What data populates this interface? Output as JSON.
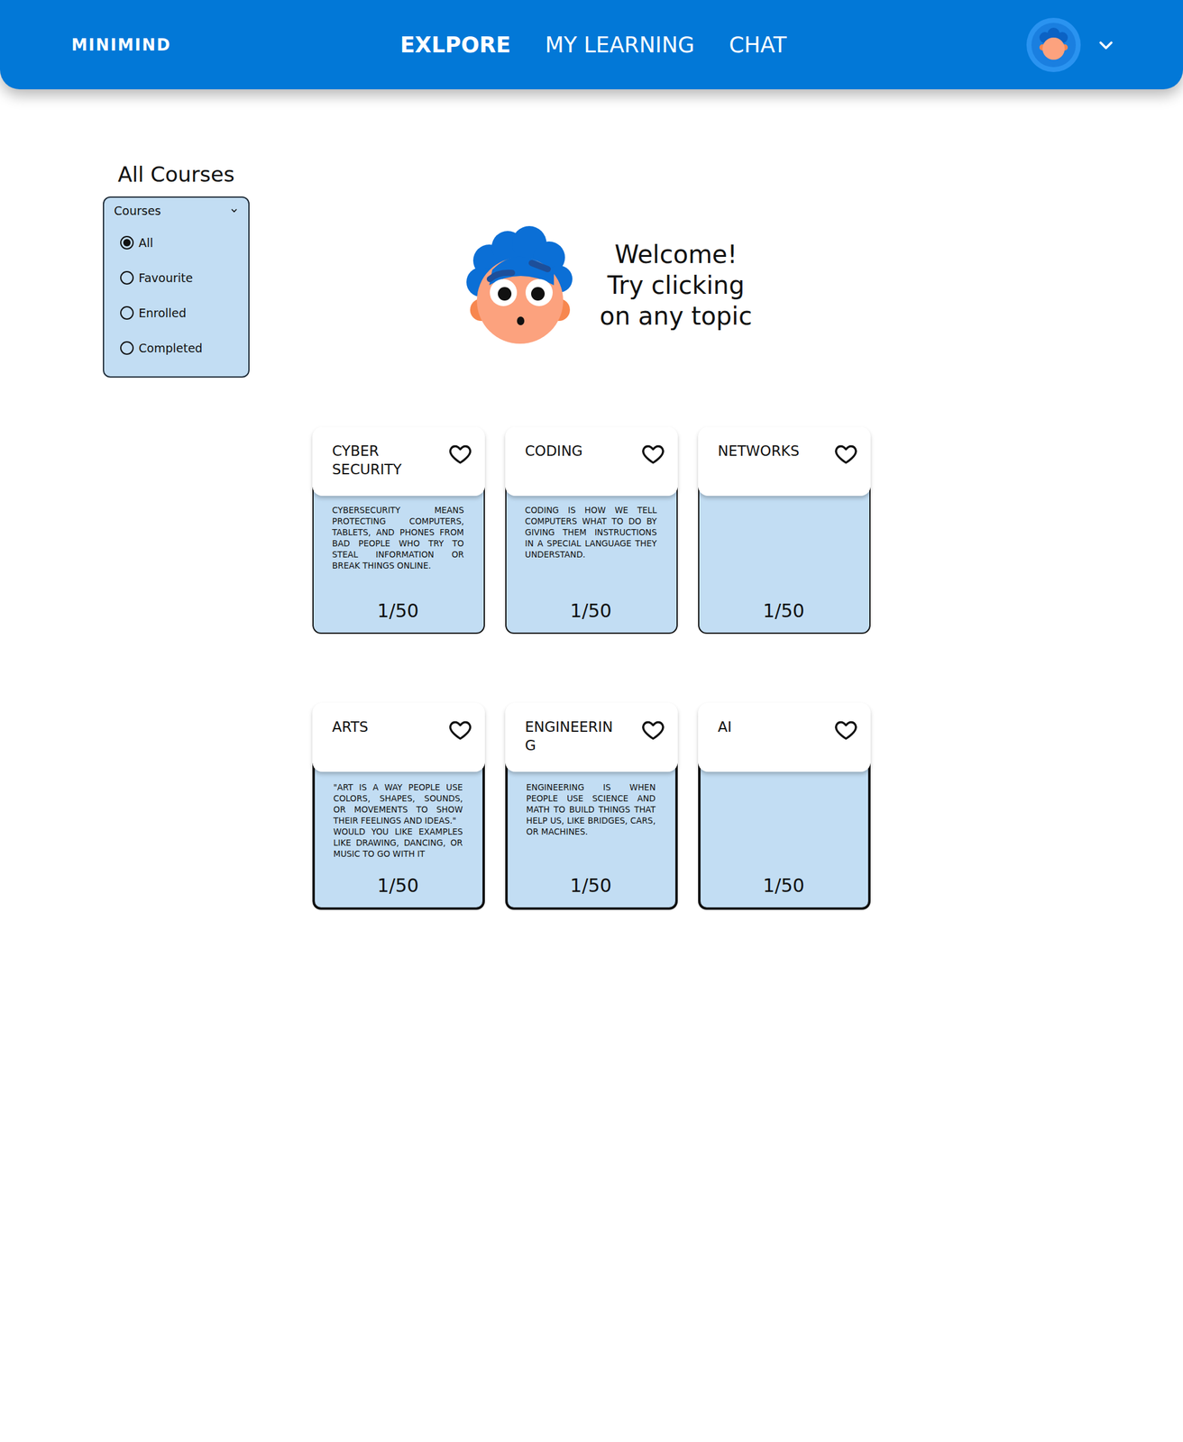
{
  "header": {
    "logo": "MINIMIND",
    "nav": [
      {
        "label": "EXLPORE",
        "selected": true
      },
      {
        "label": "MY LEARNING",
        "selected": false
      },
      {
        "label": "CHAT",
        "selected": false
      }
    ]
  },
  "filter": {
    "title": "All Courses",
    "label": "Courses",
    "options": [
      {
        "label": "All",
        "selected": true
      },
      {
        "label": "Favourite",
        "selected": false
      },
      {
        "label": "Enrolled",
        "selected": false
      },
      {
        "label": "Completed",
        "selected": false
      }
    ]
  },
  "welcome": {
    "lines": [
      "Welcome!",
      "Try clicking",
      "on any topic"
    ]
  },
  "courses": [
    {
      "title": "CYBER SECURITY",
      "favourite": false,
      "description": "CYBERSECURITY MEANS PROTECTING COMPUTERS, TABLETS, AND PHONES FROM BAD PEOPLE WHO TRY TO STEAL INFORMATION OR BREAK THINGS ONLINE.",
      "progress": "1/50"
    },
    {
      "title": "CODING",
      "favourite": false,
      "description": "CODING IS HOW WE TELL COMPUTERS WHAT TO DO BY GIVING THEM INSTRUCTIONS IN A SPECIAL LANGUAGE THEY UNDERSTAND.",
      "progress": "1/50"
    },
    {
      "title": "NETWORKS",
      "favourite": false,
      "description": "",
      "progress": "1/50"
    },
    {
      "title": "ARTS",
      "favourite": false,
      "description": "\"ART IS A WAY PEOPLE USE COLORS, SHAPES, SOUNDS, OR MOVEMENTS TO SHOW THEIR FEELINGS AND IDEAS.\"\nWOULD YOU LIKE EXAMPLES LIKE DRAWING, DANCING, OR MUSIC TO GO WITH IT",
      "progress": "1/50"
    },
    {
      "title": "ENGINEERING",
      "favourite": false,
      "description": "ENGINEERING IS WHEN PEOPLE USE SCIENCE AND MATH TO BUILD THINGS THAT HELP US, LIKE BRIDGES, CARS, OR MACHINES.",
      "progress": "1/50"
    },
    {
      "title": "AI",
      "favourite": false,
      "description": "",
      "progress": "1/50"
    }
  ]
}
